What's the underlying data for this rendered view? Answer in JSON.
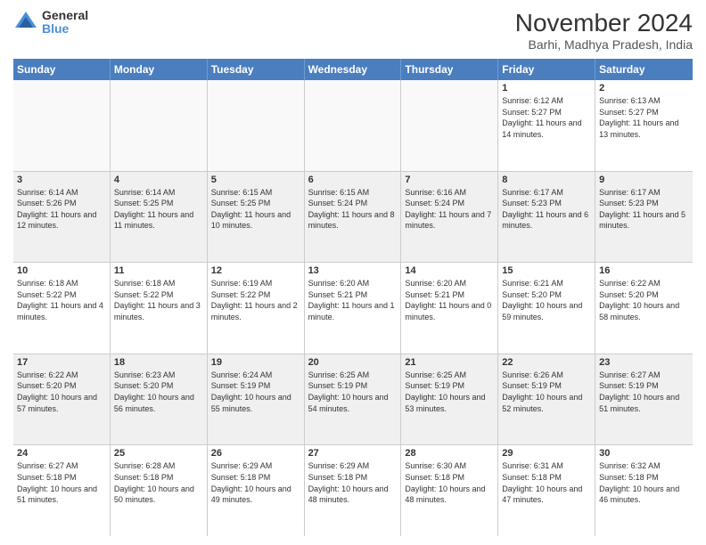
{
  "logo": {
    "general": "General",
    "blue": "Blue"
  },
  "title": "November 2024",
  "subtitle": "Barhi, Madhya Pradesh, India",
  "headers": [
    "Sunday",
    "Monday",
    "Tuesday",
    "Wednesday",
    "Thursday",
    "Friday",
    "Saturday"
  ],
  "weeks": [
    [
      {
        "day": "",
        "info": "",
        "empty": true
      },
      {
        "day": "",
        "info": "",
        "empty": true
      },
      {
        "day": "",
        "info": "",
        "empty": true
      },
      {
        "day": "",
        "info": "",
        "empty": true
      },
      {
        "day": "",
        "info": "",
        "empty": true
      },
      {
        "day": "1",
        "info": "Sunrise: 6:12 AM\nSunset: 5:27 PM\nDaylight: 11 hours and 14 minutes.",
        "empty": false
      },
      {
        "day": "2",
        "info": "Sunrise: 6:13 AM\nSunset: 5:27 PM\nDaylight: 11 hours and 13 minutes.",
        "empty": false
      }
    ],
    [
      {
        "day": "3",
        "info": "Sunrise: 6:14 AM\nSunset: 5:26 PM\nDaylight: 11 hours and 12 minutes.",
        "empty": false
      },
      {
        "day": "4",
        "info": "Sunrise: 6:14 AM\nSunset: 5:25 PM\nDaylight: 11 hours and 11 minutes.",
        "empty": false
      },
      {
        "day": "5",
        "info": "Sunrise: 6:15 AM\nSunset: 5:25 PM\nDaylight: 11 hours and 10 minutes.",
        "empty": false
      },
      {
        "day": "6",
        "info": "Sunrise: 6:15 AM\nSunset: 5:24 PM\nDaylight: 11 hours and 8 minutes.",
        "empty": false
      },
      {
        "day": "7",
        "info": "Sunrise: 6:16 AM\nSunset: 5:24 PM\nDaylight: 11 hours and 7 minutes.",
        "empty": false
      },
      {
        "day": "8",
        "info": "Sunrise: 6:17 AM\nSunset: 5:23 PM\nDaylight: 11 hours and 6 minutes.",
        "empty": false
      },
      {
        "day": "9",
        "info": "Sunrise: 6:17 AM\nSunset: 5:23 PM\nDaylight: 11 hours and 5 minutes.",
        "empty": false
      }
    ],
    [
      {
        "day": "10",
        "info": "Sunrise: 6:18 AM\nSunset: 5:22 PM\nDaylight: 11 hours and 4 minutes.",
        "empty": false
      },
      {
        "day": "11",
        "info": "Sunrise: 6:18 AM\nSunset: 5:22 PM\nDaylight: 11 hours and 3 minutes.",
        "empty": false
      },
      {
        "day": "12",
        "info": "Sunrise: 6:19 AM\nSunset: 5:22 PM\nDaylight: 11 hours and 2 minutes.",
        "empty": false
      },
      {
        "day": "13",
        "info": "Sunrise: 6:20 AM\nSunset: 5:21 PM\nDaylight: 11 hours and 1 minute.",
        "empty": false
      },
      {
        "day": "14",
        "info": "Sunrise: 6:20 AM\nSunset: 5:21 PM\nDaylight: 11 hours and 0 minutes.",
        "empty": false
      },
      {
        "day": "15",
        "info": "Sunrise: 6:21 AM\nSunset: 5:20 PM\nDaylight: 10 hours and 59 minutes.",
        "empty": false
      },
      {
        "day": "16",
        "info": "Sunrise: 6:22 AM\nSunset: 5:20 PM\nDaylight: 10 hours and 58 minutes.",
        "empty": false
      }
    ],
    [
      {
        "day": "17",
        "info": "Sunrise: 6:22 AM\nSunset: 5:20 PM\nDaylight: 10 hours and 57 minutes.",
        "empty": false
      },
      {
        "day": "18",
        "info": "Sunrise: 6:23 AM\nSunset: 5:20 PM\nDaylight: 10 hours and 56 minutes.",
        "empty": false
      },
      {
        "day": "19",
        "info": "Sunrise: 6:24 AM\nSunset: 5:19 PM\nDaylight: 10 hours and 55 minutes.",
        "empty": false
      },
      {
        "day": "20",
        "info": "Sunrise: 6:25 AM\nSunset: 5:19 PM\nDaylight: 10 hours and 54 minutes.",
        "empty": false
      },
      {
        "day": "21",
        "info": "Sunrise: 6:25 AM\nSunset: 5:19 PM\nDaylight: 10 hours and 53 minutes.",
        "empty": false
      },
      {
        "day": "22",
        "info": "Sunrise: 6:26 AM\nSunset: 5:19 PM\nDaylight: 10 hours and 52 minutes.",
        "empty": false
      },
      {
        "day": "23",
        "info": "Sunrise: 6:27 AM\nSunset: 5:19 PM\nDaylight: 10 hours and 51 minutes.",
        "empty": false
      }
    ],
    [
      {
        "day": "24",
        "info": "Sunrise: 6:27 AM\nSunset: 5:18 PM\nDaylight: 10 hours and 51 minutes.",
        "empty": false
      },
      {
        "day": "25",
        "info": "Sunrise: 6:28 AM\nSunset: 5:18 PM\nDaylight: 10 hours and 50 minutes.",
        "empty": false
      },
      {
        "day": "26",
        "info": "Sunrise: 6:29 AM\nSunset: 5:18 PM\nDaylight: 10 hours and 49 minutes.",
        "empty": false
      },
      {
        "day": "27",
        "info": "Sunrise: 6:29 AM\nSunset: 5:18 PM\nDaylight: 10 hours and 48 minutes.",
        "empty": false
      },
      {
        "day": "28",
        "info": "Sunrise: 6:30 AM\nSunset: 5:18 PM\nDaylight: 10 hours and 48 minutes.",
        "empty": false
      },
      {
        "day": "29",
        "info": "Sunrise: 6:31 AM\nSunset: 5:18 PM\nDaylight: 10 hours and 47 minutes.",
        "empty": false
      },
      {
        "day": "30",
        "info": "Sunrise: 6:32 AM\nSunset: 5:18 PM\nDaylight: 10 hours and 46 minutes.",
        "empty": false
      }
    ]
  ]
}
